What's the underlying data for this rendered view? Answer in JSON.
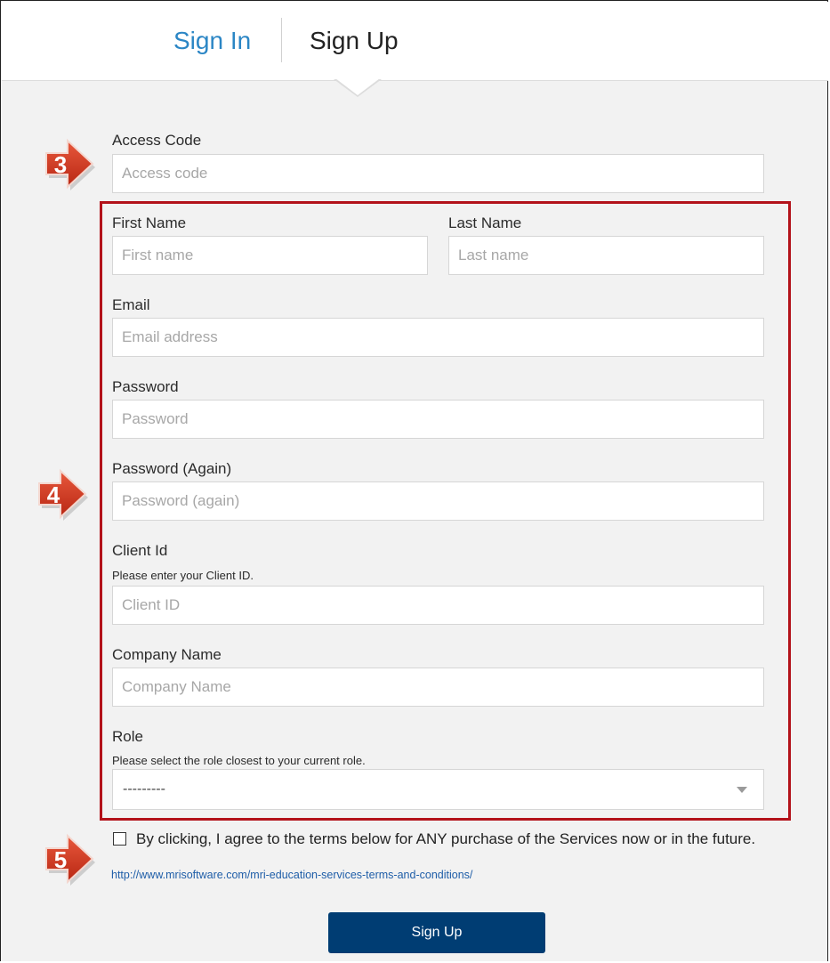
{
  "tabs": {
    "sign_in": "Sign In",
    "sign_up": "Sign Up"
  },
  "form": {
    "access_code": {
      "label": "Access Code",
      "placeholder": "Access code"
    },
    "first_name": {
      "label": "First Name",
      "placeholder": "First name"
    },
    "last_name": {
      "label": "Last Name",
      "placeholder": "Last name"
    },
    "email": {
      "label": "Email",
      "placeholder": "Email address"
    },
    "password": {
      "label": "Password",
      "placeholder": "Password"
    },
    "password_again": {
      "label": "Password (Again)",
      "placeholder": "Password (again)"
    },
    "client_id": {
      "label": "Client Id",
      "helper": "Please enter your Client ID.",
      "placeholder": "Client ID"
    },
    "company_name": {
      "label": "Company Name",
      "placeholder": "Company Name"
    },
    "role": {
      "label": "Role",
      "helper": "Please select the role closest to your current role.",
      "selected": "---------"
    },
    "terms": {
      "text": "By clicking, I agree to the terms below for ANY purchase of the Services now or in the future.",
      "link": "http://www.mrisoftware.com/mri-education-services-terms-and-conditions/"
    },
    "submit_label": "Sign Up"
  },
  "callouts": {
    "step_3": "3",
    "step_4": "4",
    "step_5": "5"
  },
  "colors": {
    "link_blue": "#2b86c5",
    "button_navy": "#003d73",
    "highlight_red": "#b3121a",
    "callout_red": "#d2351f"
  }
}
